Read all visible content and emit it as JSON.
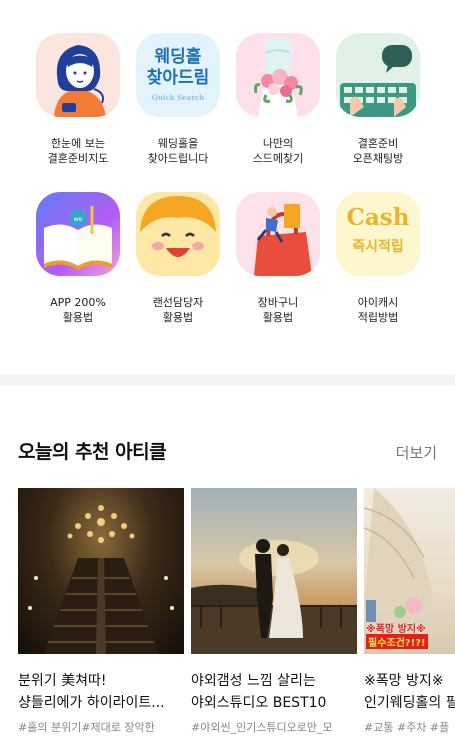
{
  "menu": [
    {
      "line1": "한눈에 보는",
      "line2": "결혼준비지도",
      "icon": "woman-phone-icon",
      "bg": "#fbe6df"
    },
    {
      "line1": "웨딩홀을",
      "line2": "찾아드립니다",
      "icon": "wedding-hall-search-icon",
      "bg": "#e3f3fb",
      "badge1": "웨딩홀",
      "badge2": "찾아드림",
      "badge3": "Quick Search"
    },
    {
      "line1": "나만의",
      "line2": "스드메찾기",
      "icon": "wedding-dress-icon",
      "bg": "#fde0ea"
    },
    {
      "line1": "결혼준비",
      "line2": "오픈채팅방",
      "icon": "keyboard-chat-icon",
      "bg": "#e1f1e8"
    },
    {
      "line1": "APP 200%",
      "line2": "활용법",
      "icon": "app-book-icon",
      "bg": "#a46cf5"
    },
    {
      "line1": "랜선담당자",
      "line2": "활용법",
      "icon": "smiling-face-icon",
      "bg": "#ffe7a6"
    },
    {
      "line1": "장바구니",
      "line2": "활용법",
      "icon": "shopping-bag-icon",
      "bg": "#fde2ea"
    },
    {
      "line1": "아이캐시",
      "line2": "적립방법",
      "icon": "cash-icon",
      "bg": "#fdf7d0",
      "badge1": "Cash",
      "badge2": "즉시적립"
    }
  ],
  "section": {
    "title": "오늘의 추천 아티클",
    "more": "더보기"
  },
  "articles": [
    {
      "title1": "분위기 美쳐따!",
      "title2": "샹들리에가 하이라이트...",
      "tags": "#홀의 분위기#제대로 장악한",
      "image": "chandelier-hall-photo"
    },
    {
      "title1": "야외갬성 느낌 살리는",
      "title2": "야외스튜디오 BEST10",
      "tags": "#야외씬_인기스튜디오로만_모",
      "image": "outdoor-couple-photo"
    },
    {
      "title1": "※폭망 방지※",
      "title2": "인기웨딩홀의 필",
      "tags": "#교통 #주차 #플",
      "image": "bright-hall-photo",
      "overlay1": "※폭망 방지※",
      "overlay2": "필수조건?!?!"
    }
  ]
}
